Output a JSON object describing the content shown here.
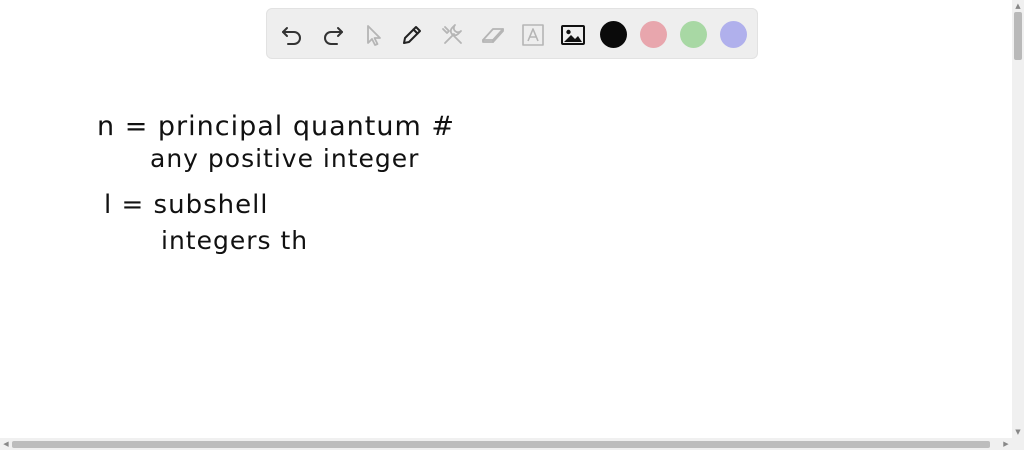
{
  "toolbar": {
    "tools": [
      {
        "name": "undo-icon",
        "enabled": true
      },
      {
        "name": "redo-icon",
        "enabled": true
      },
      {
        "name": "select-pointer-icon",
        "enabled": false
      },
      {
        "name": "pen-icon",
        "enabled": true
      },
      {
        "name": "tools-icon",
        "enabled": false
      },
      {
        "name": "eraser-icon",
        "enabled": false
      },
      {
        "name": "text-box-icon",
        "enabled": false
      },
      {
        "name": "image-icon",
        "enabled": true
      }
    ],
    "colors": [
      {
        "name": "black",
        "hex": "#0a0a0a",
        "selected": true
      },
      {
        "name": "red",
        "hex": "#e8a6ad",
        "selected": false
      },
      {
        "name": "green",
        "hex": "#a8d8a4",
        "selected": false
      },
      {
        "name": "purple",
        "hex": "#b0b0ec",
        "selected": false
      }
    ]
  },
  "notes": {
    "line1": "n = principal quantum #",
    "line2": "any positive integer",
    "line3": "l = subshell",
    "line4": "integers th"
  }
}
